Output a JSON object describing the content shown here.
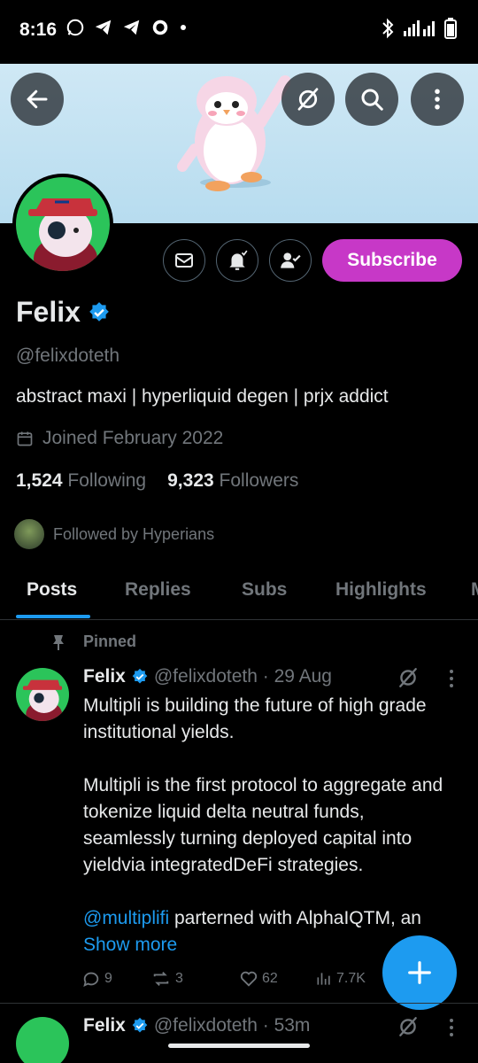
{
  "status_bar": {
    "time": "8:16"
  },
  "profile": {
    "name": "Felix",
    "handle": "@felixdoteth",
    "bio": "abstract maxi |  hyperliquid degen |  prjx addict",
    "joined": "Joined February 2022",
    "following_count": "1,524",
    "following_label": "Following",
    "followers_count": "9,323",
    "followers_label": "Followers",
    "followed_by": "Followed by Hyperians",
    "subscribe_label": "Subscribe"
  },
  "tabs": [
    {
      "label": "Posts"
    },
    {
      "label": "Replies"
    },
    {
      "label": "Subs"
    },
    {
      "label": "Highlights"
    },
    {
      "label": "M"
    }
  ],
  "pinned_post": {
    "pinned_label": "Pinned",
    "author": "Felix",
    "handle_time": "@felixdoteth · 29 Aug",
    "line1": "Multipli is building the future of high grade institutional yields.",
    "line2": "Multipli is the first protocol to aggregate and tokenize liquid delta neutral funds, seamlessly turning deployed capital into yieldvia integratedDeFi strategies.",
    "mention": "@multiplifi",
    "line3_rest": " parterned with AlphaIQTM, an ",
    "show_more": "Show more",
    "replies": "9",
    "reposts": "3",
    "likes": "62",
    "views": "7.7K"
  },
  "second_post": {
    "author": "Felix",
    "handle_time": "@felixdoteth · 53m"
  },
  "colors": {
    "accent": "#1d9bf0",
    "subscribe": "#c738c7",
    "muted": "#71767b",
    "avatar_bg": "#2bc45a"
  },
  "icons": [
    "back-arrow-icon",
    "grok-icon",
    "search-icon",
    "more-vertical-icon",
    "mail-icon",
    "bell-icon",
    "follow-icon",
    "verified-icon",
    "calendar-icon",
    "pin-icon",
    "reply-icon",
    "repost-icon",
    "like-icon",
    "views-icon",
    "plus-icon"
  ]
}
